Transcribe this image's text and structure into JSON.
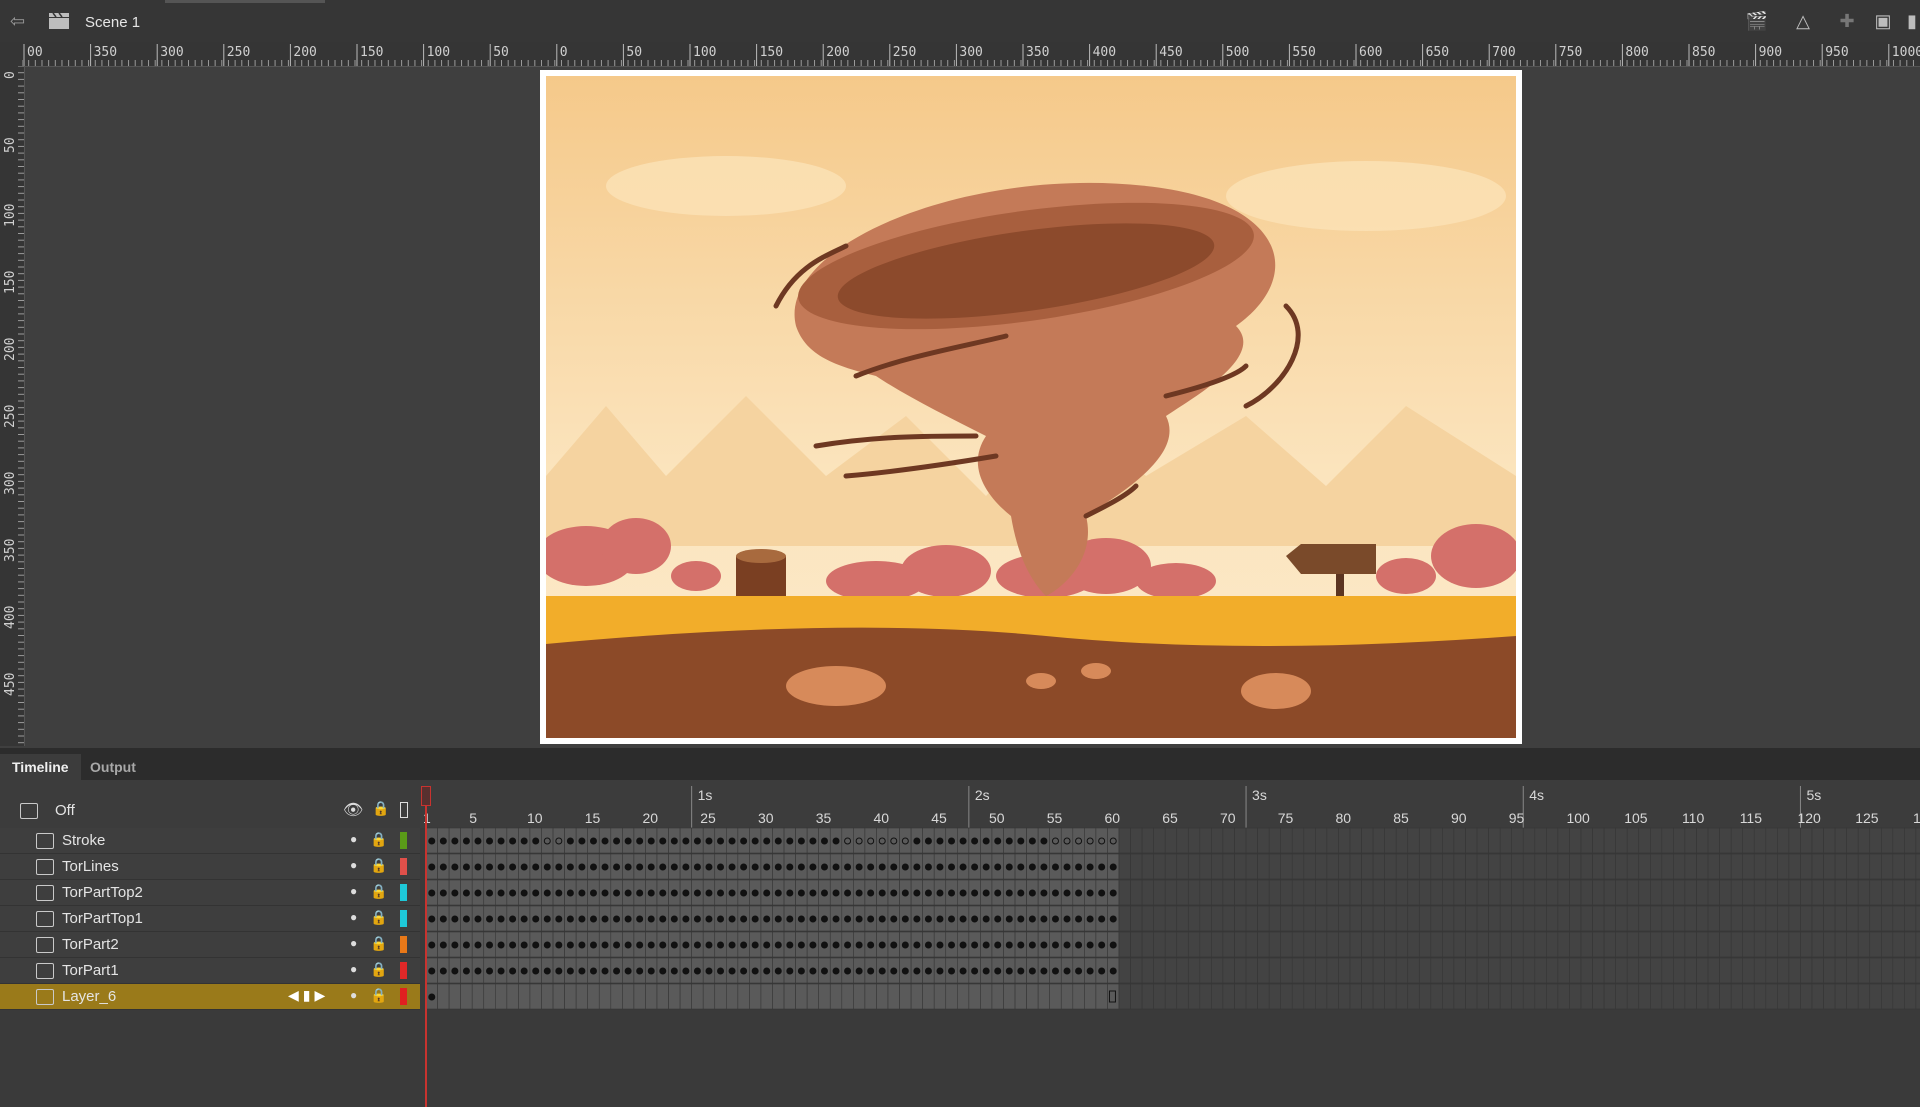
{
  "topbar": {
    "scene_label": "Scene 1",
    "tool_icons": [
      "edit-scene-icon",
      "edit-symbol-icon",
      "snap-icon",
      "clip-icon",
      "panel-icon"
    ]
  },
  "rulers": {
    "horizontal_labels": [
      "00",
      "350",
      "300",
      "250",
      "200",
      "150",
      "100",
      "50",
      "0",
      "50",
      "100",
      "150",
      "200",
      "250",
      "300",
      "350",
      "400",
      "450",
      "500",
      "550",
      "600",
      "650",
      "700",
      "750",
      "800",
      "850",
      "900",
      "950",
      "1000"
    ],
    "vertical_labels": [
      "0",
      "50",
      "100",
      "150",
      "200",
      "250",
      "300",
      "350",
      "400",
      "450"
    ]
  },
  "panel": {
    "tabs": [
      "Timeline",
      "Output"
    ],
    "onion_label": "Off",
    "time_markers": [
      "1s",
      "2s",
      "3s",
      "4s",
      "5s"
    ],
    "frame_numbers": [
      "1",
      "5",
      "10",
      "15",
      "20",
      "25",
      "30",
      "35",
      "40",
      "45",
      "50",
      "55",
      "60",
      "65",
      "70",
      "75",
      "80",
      "85",
      "90",
      "95",
      "100",
      "105",
      "110",
      "115",
      "120",
      "125",
      "13"
    ],
    "layers": [
      {
        "name": "Stroke",
        "color": "#5a9a18"
      },
      {
        "name": "TorLines",
        "color": "#e0504a"
      },
      {
        "name": "TorPartTop2",
        "color": "#1ec8d8"
      },
      {
        "name": "TorPartTop1",
        "color": "#1ec8d8"
      },
      {
        "name": "TorPart2",
        "color": "#e87818"
      },
      {
        "name": "TorPart1",
        "color": "#e02828"
      },
      {
        "name": "Layer_6",
        "color": "#e02020",
        "selected": true
      }
    ]
  },
  "colors": {
    "selected_layer": "#9a7a1a",
    "playhead": "#c8332f"
  }
}
